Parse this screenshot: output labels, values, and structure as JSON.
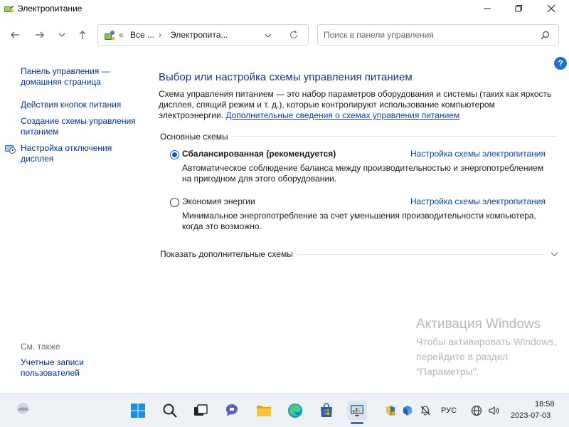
{
  "window": {
    "title": "Электропитание"
  },
  "address": {
    "overflow": "«",
    "crumb1": "Все ...",
    "sep": "›",
    "crumb2": "Электропита..."
  },
  "search": {
    "placeholder": "Поиск в панели управления"
  },
  "help": {
    "label": "?"
  },
  "sidebar": {
    "home": "Панель управления — домашняя страница",
    "power_buttons": "Действия кнопок питания",
    "create_plan": "Создание схемы управления питанием",
    "sleep_settings": "Настройка отключения дисплея",
    "see_also": "См. также",
    "user_accounts": "Учетные записи пользователей"
  },
  "main": {
    "title": "Выбор или настройка схемы управления питанием",
    "description": "Схема управления питанием — это набор параметров оборудования и системы (таких как яркость дисплея, спящий режим и т. д.), которые контролируют использование компьютером электроэнергии. ",
    "more_info_link": "Дополнительные сведения о схемах управления питанием",
    "group_title": "Основные схемы",
    "plans": [
      {
        "name": "Сбалансированная (рекомендуется)",
        "selected": true,
        "link": "Настройка схемы электропитания",
        "description": "Автоматическое соблюдение баланса между производительностью и энергопотреблением на пригодном для этого оборудовании."
      },
      {
        "name": "Экономия энергии",
        "selected": false,
        "link": "Настройка схемы электропитания",
        "description": "Минимальное энергопотребление за счет уменьшения производительности компьютера, когда это возможно."
      }
    ],
    "show_more": "Показать дополнительные схемы"
  },
  "watermark": {
    "title": "Активация Windows",
    "text": "Чтобы активировать Windows, перейдите в раздел \"Параметры\"."
  },
  "taskbar": {
    "language": "РУС",
    "time": "18:58",
    "date": "2023-07-03"
  },
  "colors": {
    "accent": "#1f73c7",
    "link": "#0645ad",
    "title": "#1e3287"
  }
}
